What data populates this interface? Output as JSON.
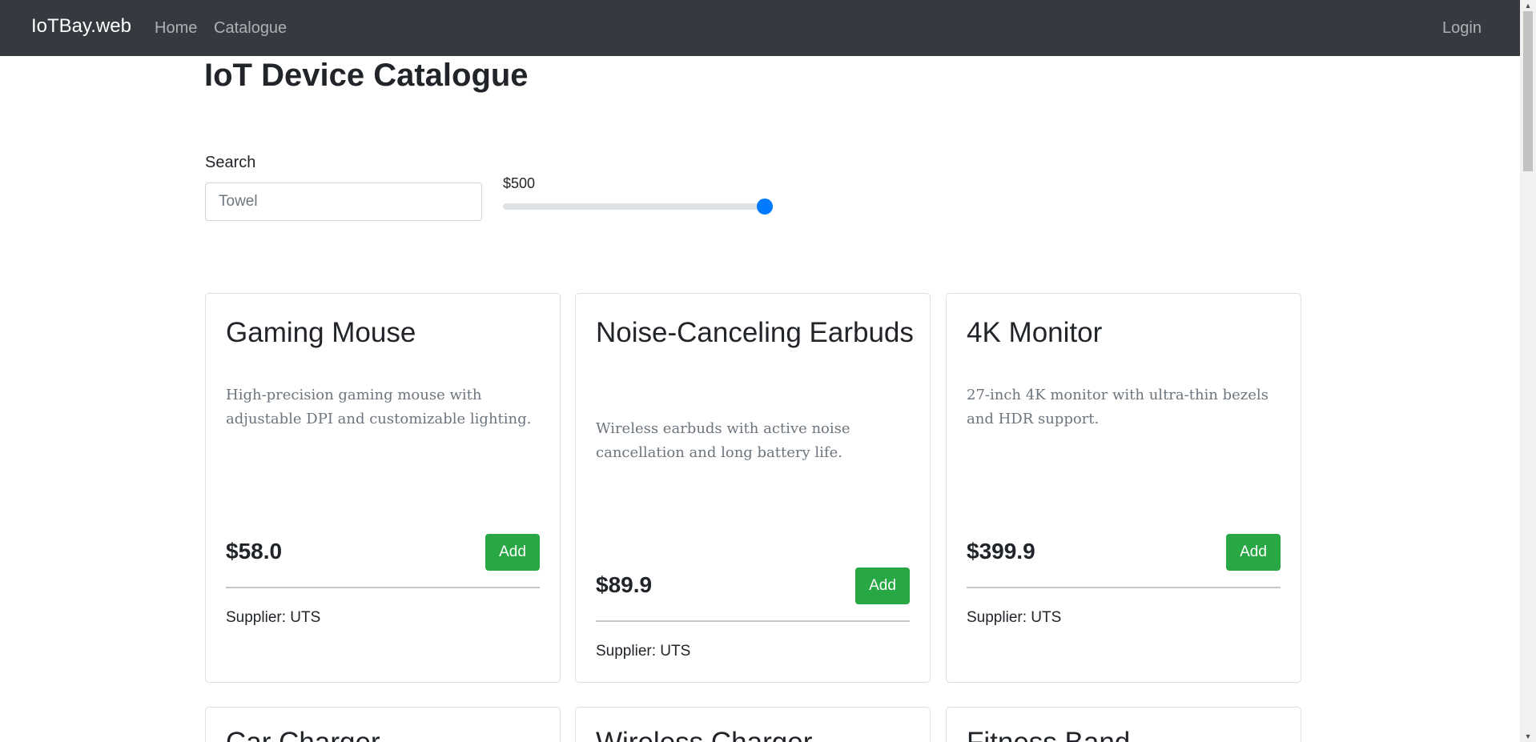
{
  "navbar": {
    "brand": "IoTBay.web",
    "links": [
      "Home",
      "Catalogue"
    ],
    "login": "Login"
  },
  "page_title": "IoT Device Catalogue",
  "search": {
    "label": "Search",
    "placeholder": "Towel"
  },
  "price_filter": {
    "label": "$500",
    "level_fraction": 1.0
  },
  "products": [
    {
      "name": "Gaming Mouse",
      "description": "High-precision gaming mouse with adjustable DPI and customizable lighting.",
      "price": "$58.0",
      "add_label": "Add",
      "supplier": "Supplier: UTS"
    },
    {
      "name": "Noise-Canceling Earbuds",
      "description": "Wireless earbuds with active noise cancellation and long battery life.",
      "price": "$89.9",
      "add_label": "Add",
      "supplier": "Supplier: UTS"
    },
    {
      "name": "4K Monitor",
      "description": "27-inch 4K monitor with ultra-thin bezels and HDR support.",
      "price": "$399.9",
      "add_label": "Add",
      "supplier": "Supplier: UTS"
    }
  ],
  "partial_products": [
    {
      "name": "Car Charger"
    },
    {
      "name": "Wireless Charger"
    },
    {
      "name": "Fitness Band"
    }
  ],
  "colors": {
    "navbar": "#343a40",
    "add_button": "#28a745",
    "slider_thumb": "#007bff"
  }
}
